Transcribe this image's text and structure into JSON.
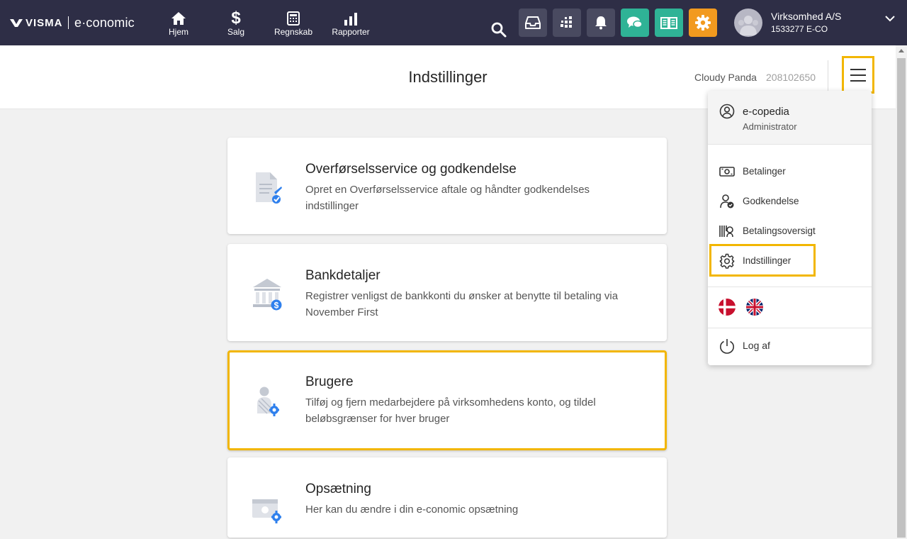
{
  "topbar": {
    "logo_brand": "VISMA",
    "logo_product": "e·conomic",
    "nav": [
      {
        "label": "Hjem",
        "icon": "home-icon"
      },
      {
        "label": "Salg",
        "icon": "dollar-icon"
      },
      {
        "label": "Regnskab",
        "icon": "calculator-icon"
      },
      {
        "label": "Rapporter",
        "icon": "bar-chart-icon"
      }
    ],
    "company_name": "Virksomhed A/S",
    "company_number": "1533277 E-CO"
  },
  "header": {
    "title": "Indstillinger",
    "user_name": "Cloudy Panda",
    "user_number": "208102650"
  },
  "cards": [
    {
      "title": "Overførselsservice og godkendelse",
      "description": "Opret en Overførselsservice aftale og håndter godkendelses indstillinger"
    },
    {
      "title": "Bankdetaljer",
      "description": "Registrer venligst de bankkonti du ønsker at benytte til betaling via November First"
    },
    {
      "title": "Brugere",
      "description": "Tilføj og fjern medarbejdere på virksomhedens konto, og tildel beløbsgrænser for hver bruger"
    },
    {
      "title": "Opsætning",
      "description": "Her kan du ændre i din e-conomic opsætning"
    }
  ],
  "menu": {
    "user_name": "e-copedia",
    "user_role": "Administrator",
    "items": [
      {
        "label": "Betalinger",
        "icon": "banknote-icon"
      },
      {
        "label": "Godkendelse",
        "icon": "user-check-icon"
      },
      {
        "label": "Betalingsoversigt",
        "icon": "barcode-search-icon"
      },
      {
        "label": "Indstillinger",
        "icon": "gear-icon"
      }
    ],
    "logout_label": "Log af"
  },
  "colors": {
    "topbar": "#2e2e46",
    "teal": "#2fb396",
    "orange": "#f29a1f",
    "highlight": "#f2b600",
    "accent_blue": "#2f80ed"
  }
}
